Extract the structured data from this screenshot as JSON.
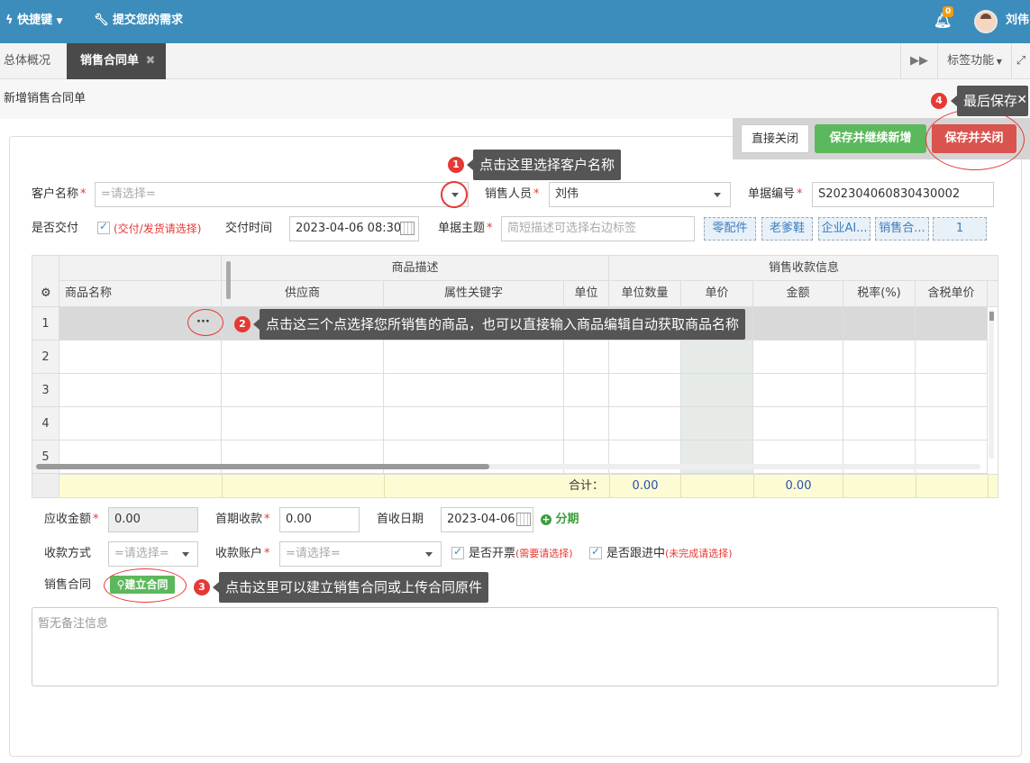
{
  "topbar": {
    "shortcut": "快捷键",
    "request": "提交您的需求",
    "notif_count": "0",
    "user": "刘伟"
  },
  "tabs": {
    "overview": "总体概况",
    "contract": "销售合同单",
    "tag_func": "标签功能"
  },
  "breadcrumb": {
    "title": "新增销售合同单"
  },
  "actions": {
    "close": "直接关闭",
    "save_new": "保存并继续新增",
    "save_close": "保存并关闭"
  },
  "tips": {
    "t1": "点击这里选择客户名称",
    "t2": "点击这三个点选择您所销售的商品，也可以直接输入商品编辑自动获取商品名称",
    "t3": "点击这里可以建立销售合同或上传合同原件",
    "t4": "最后保存",
    "n1": "1",
    "n2": "2",
    "n3": "3",
    "n4": "4"
  },
  "form": {
    "customer_label": "客户名称",
    "customer_ph": "=请选择=",
    "sales_label": "销售人员",
    "sales_value": "刘伟",
    "docno_label": "单据编号",
    "docno_value": "S202304060830430002",
    "deliver_label": "是否交付",
    "deliver_hint": "(交付/发货请选择)",
    "deliver_time_label": "交付时间",
    "deliver_time_value": "2023-04-06 08:30",
    "subject_label": "单据主题",
    "subject_ph": "简短描述可选择右边标签",
    "tags": [
      "零配件",
      "老爹鞋",
      "企业AI...",
      "销售合...",
      "1"
    ]
  },
  "grid": {
    "group_product": "商品描述",
    "group_payment": "销售收款信息",
    "columns": [
      "商品名称",
      "供应商",
      "属性关键字",
      "单位",
      "单位数量",
      "单价",
      "金额",
      "税率(%)",
      "含税单价"
    ],
    "rows": [
      "1",
      "2",
      "3",
      "4",
      "5"
    ],
    "ellipsis": "···",
    "total_label": "合计：",
    "total_qty": "0.00",
    "total_amount": "0.00"
  },
  "bottom": {
    "receivable_label": "应收金额",
    "receivable_value": "0.00",
    "first_label": "首期收款",
    "first_value": "0.00",
    "first_date_label": "首收日期",
    "first_date_value": "2023-04-06",
    "installment": "分期",
    "method_label": "收款方式",
    "method_ph": "=请选择=",
    "account_label": "收款账户",
    "account_ph": "=请选择=",
    "invoice_label": "是否开票",
    "invoice_hint": "(需要请选择)",
    "follow_label": "是否跟进中",
    "follow_hint": "(未完成请选择)",
    "contract_label": "销售合同",
    "contract_btn": "建立合同",
    "remark_ph": "暂无备注信息"
  }
}
